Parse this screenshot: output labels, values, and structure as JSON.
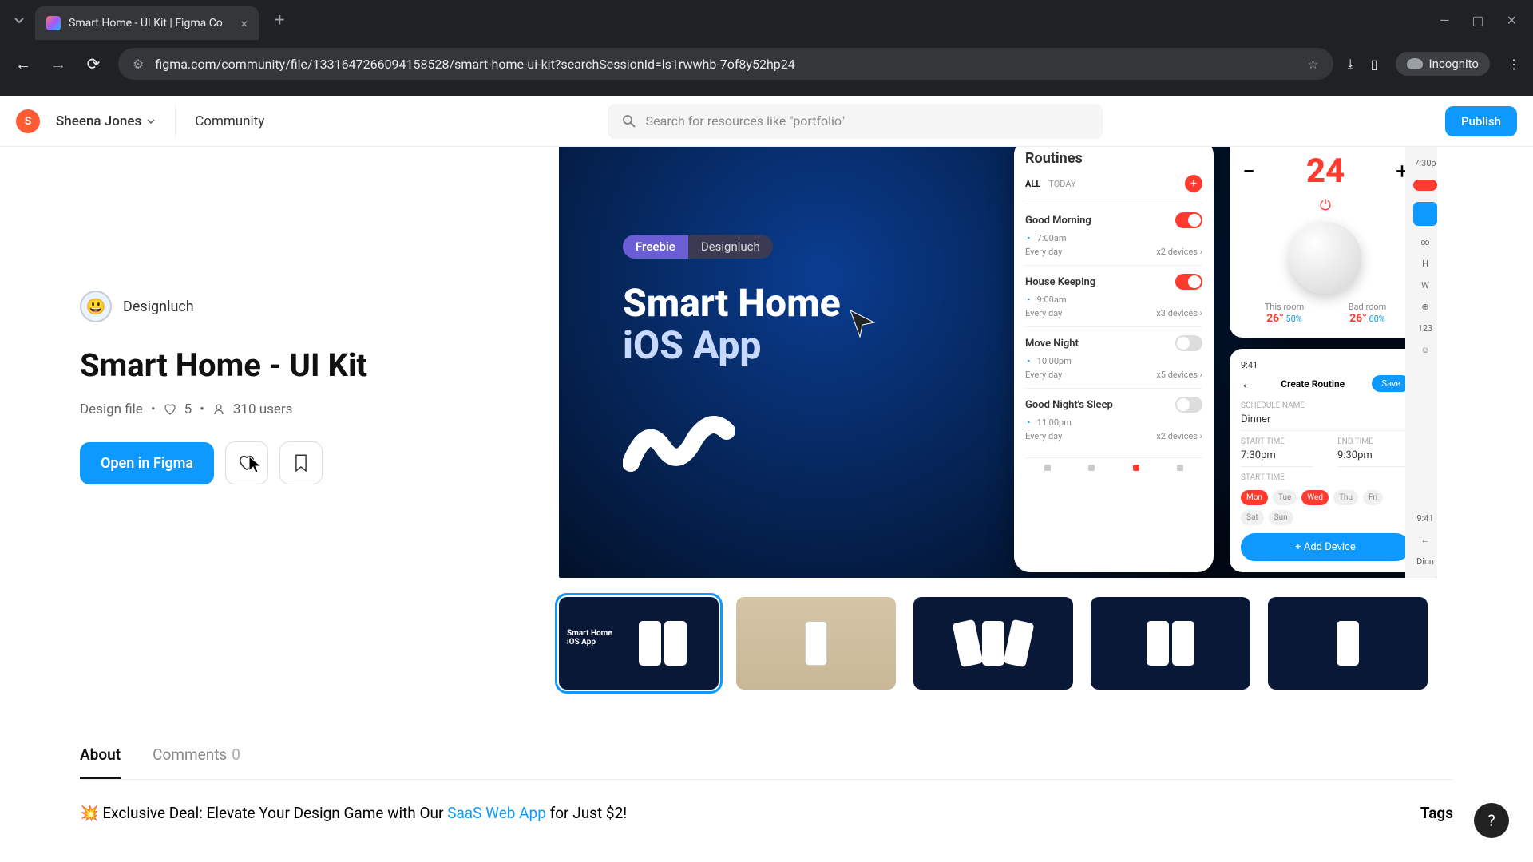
{
  "browser": {
    "tab_title": "Smart Home - UI Kit | Figma Co",
    "url": "figma.com/community/file/1331647266094158528/smart-home-ui-kit?searchSessionId=ls1rwwhb-7of8y52hp24",
    "incognito_label": "Incognito"
  },
  "header": {
    "avatar_initial": "S",
    "user_name": "Sheena Jones",
    "community_label": "Community",
    "search_placeholder": "Search for resources like \"portfolio\"",
    "publish_label": "Publish"
  },
  "resource": {
    "author": "Designluch",
    "title": "Smart Home - UI Kit",
    "file_type": "Design file",
    "likes": "5",
    "users": "310 users",
    "open_label": "Open in Figma"
  },
  "hero": {
    "pill_a": "Freebie",
    "pill_b": "Designluch",
    "line1": "Smart Home",
    "line2": "iOS App"
  },
  "routines_card": {
    "title": "Routines",
    "chip_all": "ALL",
    "chip_today": "TODAY",
    "items": [
      {
        "name": "Good Morning",
        "time": "7:00am",
        "freq": "Every day",
        "devices": "x2 devices",
        "on": true
      },
      {
        "name": "House Keeping",
        "time": "9:00am",
        "freq": "Every day",
        "devices": "x3 devices",
        "on": true
      },
      {
        "name": "Move Night",
        "time": "10:00pm",
        "freq": "Every day",
        "devices": "x5 devices",
        "on": false
      },
      {
        "name": "Good Night's Sleep",
        "time": "11:00pm",
        "freq": "Every day",
        "devices": "x2 devices",
        "on": false
      }
    ]
  },
  "thermo": {
    "minus": "−",
    "plus": "+",
    "temp": "24",
    "room_a": "This room",
    "temp_a": "26°",
    "pct_a": "50%",
    "room_b": "Bad room",
    "temp_b": "26°",
    "pct_b": "60%"
  },
  "create": {
    "time_status": "9:41",
    "title": "Create Routine",
    "save": "Save",
    "lbl_name": "SCHEDULE NAME",
    "name": "Dinner",
    "lbl_start": "START TIME",
    "lbl_end": "END TIME",
    "start": "7:30pm",
    "end": "9:30pm",
    "lbl_days": "START TIME",
    "days": [
      "Mon",
      "Tue",
      "Wed",
      "Thu",
      "Fri",
      "Sat",
      "Sun"
    ],
    "add_device": "+   Add Device"
  },
  "strip": {
    "t1": "7:30p",
    "t2": "9:41",
    "t3": "123",
    "t4": "Dinn"
  },
  "tabs": {
    "about": "About",
    "comments": "Comments",
    "comments_count": "0"
  },
  "promo": {
    "emoji": "💥",
    "pre": " Exclusive Deal: Elevate Your Design Game with Our ",
    "link": "SaaS Web App",
    "post": " for Just $2!",
    "tags_label": "Tags"
  }
}
